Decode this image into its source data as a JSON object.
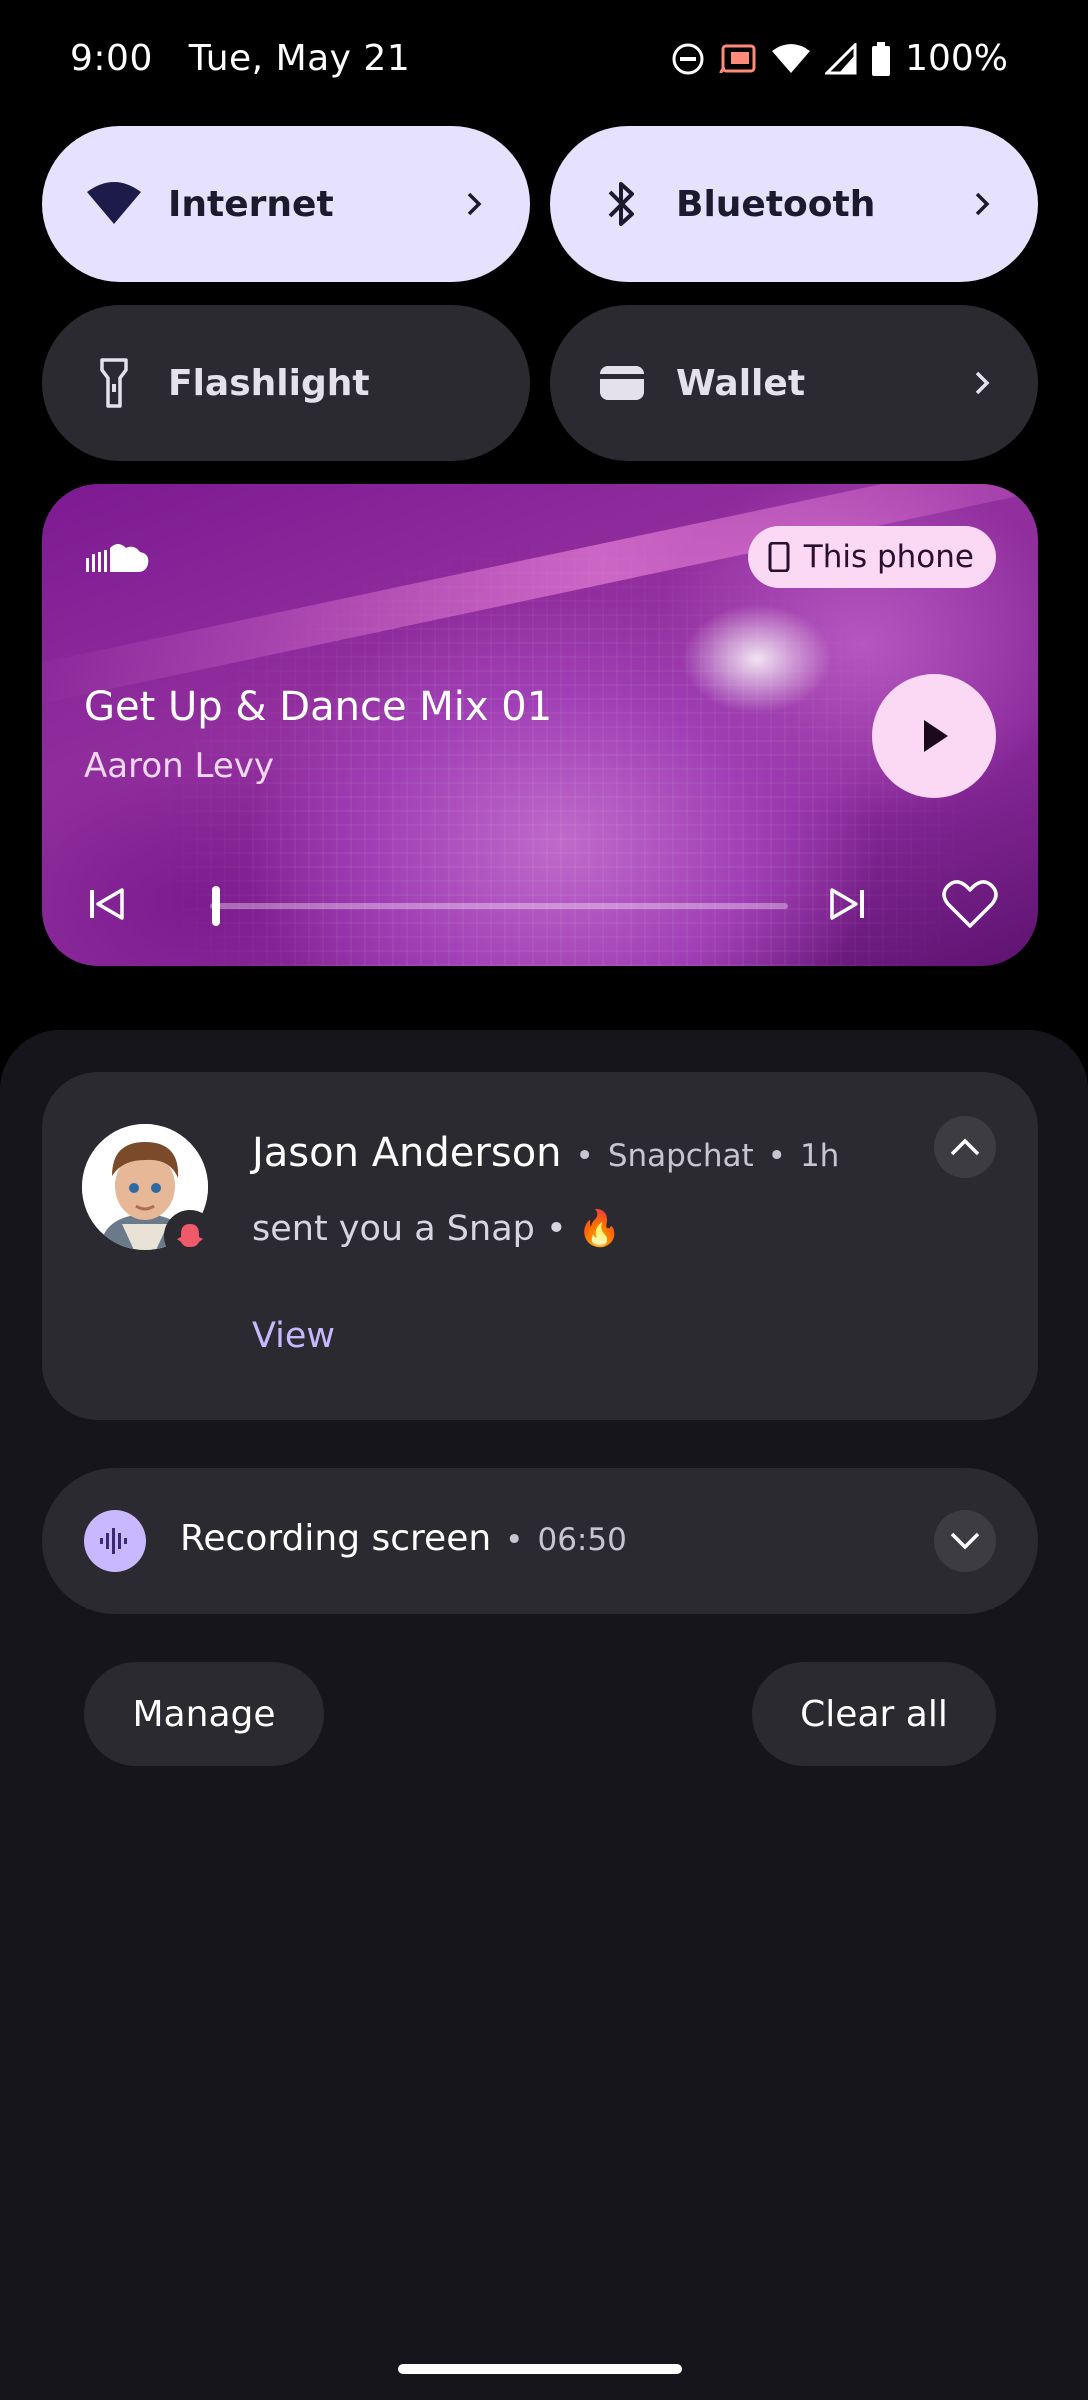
{
  "status_bar": {
    "time": "9:00",
    "date": "Tue, May 21",
    "battery": "100%",
    "icons": [
      "dnd-icon",
      "cast-icon",
      "wifi-icon",
      "signal-icon",
      "battery-icon"
    ]
  },
  "quick_tiles": [
    {
      "label": "Internet",
      "icon": "wifi-icon",
      "active": true
    },
    {
      "label": "Bluetooth",
      "icon": "bluetooth-icon",
      "active": true
    },
    {
      "label": "Flashlight",
      "icon": "flashlight-icon",
      "active": false
    },
    {
      "label": "Wallet",
      "icon": "wallet-icon",
      "active": false
    }
  ],
  "media": {
    "app_icon": "soundcloud-icon",
    "output_device": "This phone",
    "title": "Get Up & Dance Mix 01",
    "artist": "Aaron Levy",
    "progress": 0.01
  },
  "notification": {
    "sender": "Jason Anderson",
    "app": "Snapchat",
    "time": "1h",
    "text": "sent you a Snap • 🔥",
    "action": "View"
  },
  "recording": {
    "title": "Recording screen",
    "elapsed": "06:50"
  },
  "buttons": {
    "manage": "Manage",
    "clear_all": "Clear all"
  },
  "colors": {
    "tile_active": "#e6e1ff",
    "tile_inactive": "#2b2a30",
    "accent_text": "#c7b8ff",
    "chip": "#fbd9f5"
  }
}
